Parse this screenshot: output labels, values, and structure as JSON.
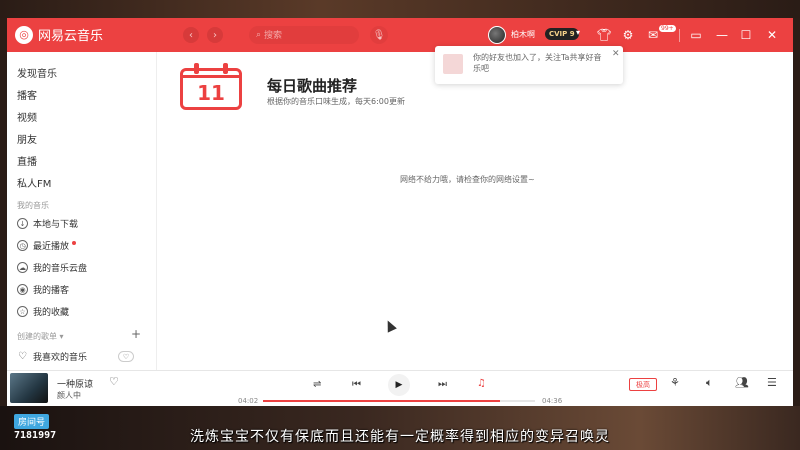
{
  "app": {
    "name": "网易云音乐",
    "logo_glyph": "◎",
    "search_placeholder": "搜索",
    "user": {
      "name": "柏木啊",
      "vip": "CVIP 9"
    },
    "titlebar_icons": [
      "skin-icon",
      "settings-icon",
      "mail-icon",
      "miniplayer-icon",
      "minimize-icon",
      "maximize-icon",
      "close-icon"
    ],
    "message_count": "99+",
    "accent": "#ec4141"
  },
  "sidebar": {
    "nav": [
      {
        "label": "发现音乐"
      },
      {
        "label": "播客"
      },
      {
        "label": "视频"
      },
      {
        "label": "朋友"
      },
      {
        "label": "直播"
      },
      {
        "label": "私人FM"
      }
    ],
    "my_music_label": "我的音乐",
    "my_music": [
      {
        "label": "本地与下载",
        "icon": "download-icon"
      },
      {
        "label": "最近播放",
        "icon": "clock-icon"
      },
      {
        "label": "我的音乐云盘",
        "icon": "cloud-icon"
      },
      {
        "label": "我的播客",
        "icon": "podcast-icon"
      },
      {
        "label": "我的收藏",
        "icon": "favorite-icon"
      }
    ],
    "created_playlists_label": "创建的歌单",
    "liked_playlist": "我喜欢的音乐"
  },
  "main": {
    "calendar_day": "11",
    "title": "每日歌曲推荐",
    "subtitle": "根据你的音乐口味生成，每天6:00更新",
    "network_error": "网络不给力哦，请检查你的网络设置~"
  },
  "notification": {
    "text": "你的好友也加入了，关注Ta共享好音乐吧"
  },
  "player": {
    "song": "一种原谅",
    "artist": "颜人中",
    "current_time": "04:02",
    "total_time": "04:36",
    "progress": 0.87,
    "quality": "极高"
  },
  "stream": {
    "room_label": "房间号",
    "room_id": "7181997",
    "subtitle": "洗炼宝宝不仅有保底而且还能有一定概率得到相应的变异召唤灵"
  }
}
